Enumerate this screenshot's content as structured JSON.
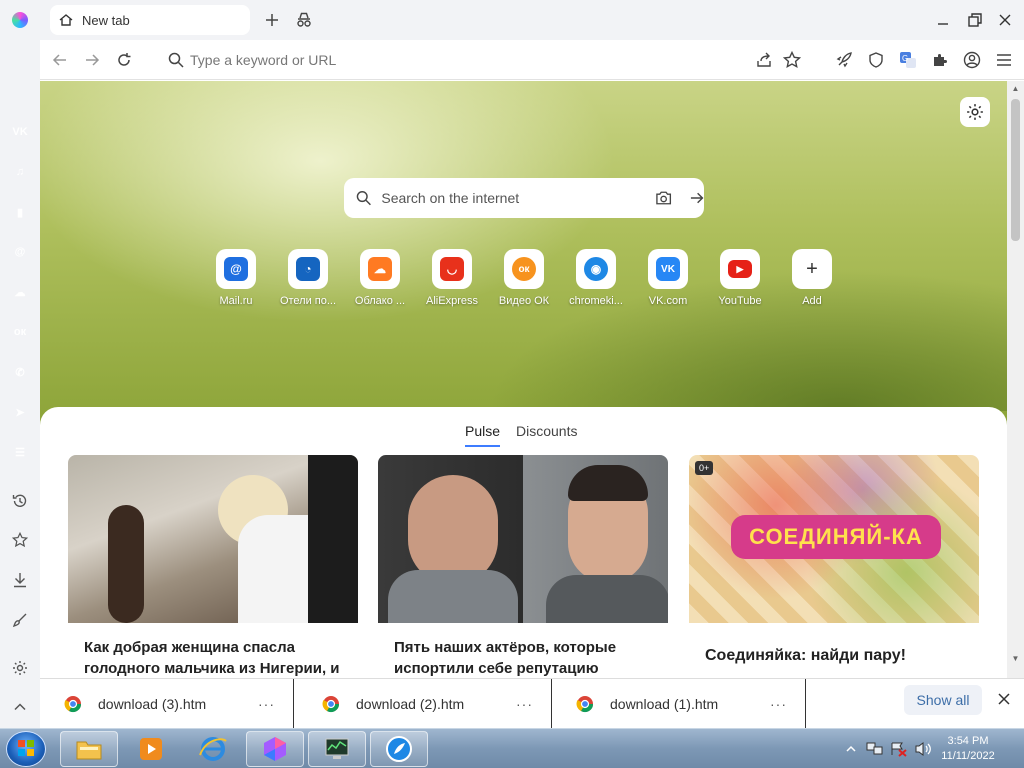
{
  "browser": {
    "tab_title": "New tab",
    "url_placeholder": "Type a keyword or URL"
  },
  "newtab": {
    "search_placeholder": "Search on the internet",
    "shortcuts": [
      {
        "label": "Mail.ru",
        "color": "#1f6fe0",
        "glyph": "@"
      },
      {
        "label": "Отели по...",
        "color": "#1565c0",
        "glyph": "◔"
      },
      {
        "label": "Облако ...",
        "color": "#ff7a22",
        "glyph": "☁"
      },
      {
        "label": "AliExpress",
        "color": "#e8311b",
        "glyph": "◡"
      },
      {
        "label": "Видео ОК",
        "color": "#f7931e",
        "glyph": "ок"
      },
      {
        "label": "chromeki...",
        "color": "#1e88e5",
        "glyph": "◉"
      },
      {
        "label": "VK.com",
        "color": "#2787f5",
        "glyph": "VK"
      },
      {
        "label": "YouTube",
        "color": "#e62117",
        "glyph": "▶"
      },
      {
        "label": "Add",
        "color": "#ffffff",
        "glyph": "+"
      }
    ],
    "feed_tabs": {
      "pulse": "Pulse",
      "discounts": "Discounts"
    },
    "cards": [
      {
        "title": "Как добрая женщина спасла голодного мальчика из Нигерии, и"
      },
      {
        "title": "Пять наших актёров, которые испортили себе репутацию"
      },
      {
        "title": "Соединяйка: найди пару!",
        "badge": "0+",
        "image_text": "СОЕДИНЯЙ-КА"
      }
    ]
  },
  "sidebar": {
    "apps": [
      {
        "name": "vk",
        "color": "#2787f5",
        "glyph": "VK"
      },
      {
        "name": "music",
        "color": "#1e88e5",
        "glyph": "♫"
      },
      {
        "name": "stats",
        "color": "#1976d2",
        "glyph": "▮"
      },
      {
        "name": "mail",
        "color": "#1f6fe0",
        "glyph": "@"
      },
      {
        "name": "cloud",
        "color": "#ff7a22",
        "glyph": "☁"
      },
      {
        "name": "ok",
        "color": "#f7931e",
        "glyph": "ок"
      },
      {
        "name": "whatsapp",
        "color": "#25d366",
        "glyph": "✆"
      },
      {
        "name": "telegram",
        "color": "#2aa3e0",
        "glyph": "➤"
      },
      {
        "name": "tasks",
        "color": "#1e64d6",
        "glyph": "☰"
      }
    ]
  },
  "downloads": {
    "items": [
      {
        "name": "download (3).htm"
      },
      {
        "name": "download (2).htm"
      },
      {
        "name": "download (1).htm"
      }
    ],
    "more": "···",
    "show_all": "Show all"
  },
  "taskbar": {
    "time": "3:54 PM",
    "date": "11/11/2022"
  },
  "colors": {
    "accent": "#3d7cff",
    "show_all_text": "#3d6ea8"
  }
}
